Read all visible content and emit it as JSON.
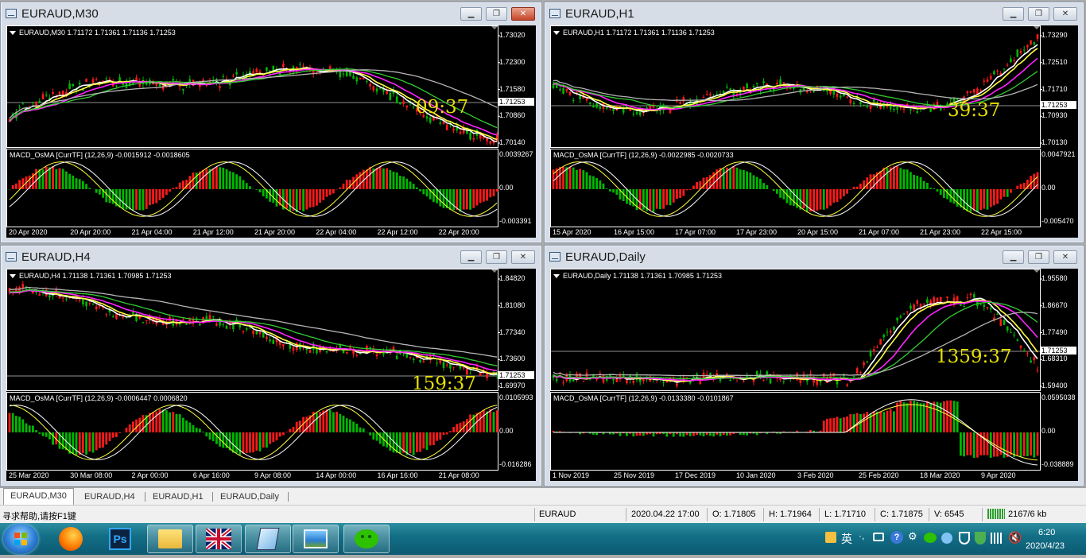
{
  "windows": [
    {
      "title": "EURAUD,M30",
      "header": "EURAUD,M30  1.71172 1.71361 1.71136 1.71253",
      "prices": [
        "1.73020",
        "1.72300",
        "1.71580",
        "1.70860",
        "1.70140"
      ],
      "current": "1.71253",
      "timer": "09:37",
      "macd": "MACD_OsMA [CurrTF] (12,26,9) -0.0015912 -0.0018605",
      "macd_scale": [
        "0.0039267",
        "0.00",
        "-0.003391"
      ],
      "x_labels": [
        "20 Apr 2020",
        "20 Apr 20:00",
        "21 Apr 04:00",
        "21 Apr 12:00",
        "21 Apr 20:00",
        "22 Apr 04:00",
        "22 Apr 12:00",
        "22 Apr 20:00"
      ]
    },
    {
      "title": "EURAUD,H1",
      "header": "EURAUD,H1  1.71172 1.71361 1.71136 1.71253",
      "prices": [
        "1.73290",
        "1.72510",
        "1.71710",
        "1.70930",
        "1.70130"
      ],
      "current": "1.71253",
      "timer": "39:37",
      "macd": "MACD_OsMA [CurrTF] (12,26,9) -0.0022985 -0.0020733",
      "macd_scale": [
        "0.0047921",
        "0.00",
        "-0.005470"
      ],
      "x_labels": [
        "15 Apr 2020",
        "16 Apr 15:00",
        "17 Apr 07:00",
        "17 Apr 23:00",
        "20 Apr 15:00",
        "21 Apr 07:00",
        "21 Apr 23:00",
        "22 Apr 15:00"
      ]
    },
    {
      "title": "EURAUD,H4",
      "header": "EURAUD,H4  1.71138 1.71361 1.70985 1.71253",
      "prices": [
        "1.84820",
        "1.81080",
        "1.77340",
        "1.73600",
        "1.69970"
      ],
      "current": "1.71253",
      "timer": "159:37",
      "macd": "MACD_OsMA [CurrTF] (12,26,9) -0.0006447 0.0006820",
      "macd_scale": [
        "0.0105993",
        "0.00",
        "-0.016286"
      ],
      "x_labels": [
        "25 Mar 2020",
        "30 Mar 08:00",
        "2 Apr 00:00",
        "6 Apr 16:00",
        "9 Apr 08:00",
        "14 Apr 00:00",
        "16 Apr 16:00",
        "21 Apr 08:00"
      ]
    },
    {
      "title": "EURAUD,Daily",
      "header": "EURAUD,Daily  1.71138 1.71361 1.70985 1.71253",
      "prices": [
        "1.95580",
        "1.86670",
        "1.77490",
        "1.68310",
        "1.59400"
      ],
      "current": "1.71253",
      "timer": "1359:37",
      "macd": "MACD_OsMA [CurrTF] (12,26,9) -0.0133380 -0.0101867",
      "macd_scale": [
        "0.0595038",
        "0.00",
        "-0.038889"
      ],
      "x_labels": [
        "1 Nov 2019",
        "25 Nov 2019",
        "17 Dec 2019",
        "10 Jan 2020",
        "3 Feb 2020",
        "25 Feb 2020",
        "18 Mar 2020",
        "9 Apr 2020"
      ]
    }
  ],
  "window_buttons": {
    "minimize": "▁",
    "restore": "❐",
    "close": "✕"
  },
  "tabs": [
    "EURAUD,M30",
    "EURAUD,H4",
    "EURAUD,H1",
    "EURAUD,Daily"
  ],
  "status": {
    "help": "寻求帮助,请按F1键",
    "symbol": "EURAUD",
    "datetime": "2020.04.22 17:00",
    "open": "O: 1.71805",
    "high": "H: 1.71964",
    "low": "L: 1.71710",
    "close": "C: 1.71875",
    "volume": "V: 6545",
    "traffic": "2167/6 kb"
  },
  "taskbar": {
    "ime": "英",
    "time": "6:20",
    "date": "2020/4/23",
    "ps_label": "Ps"
  },
  "colors": {
    "bull": "#00b800",
    "bear": "#ff1a1a",
    "ma_white": "#ffffff",
    "ma_yellow": "#ffff40",
    "ma_magenta": "#ff22ff",
    "ma_green": "#33cc33",
    "ma_gray": "#b4b4b4",
    "timer": "#e5e000"
  }
}
